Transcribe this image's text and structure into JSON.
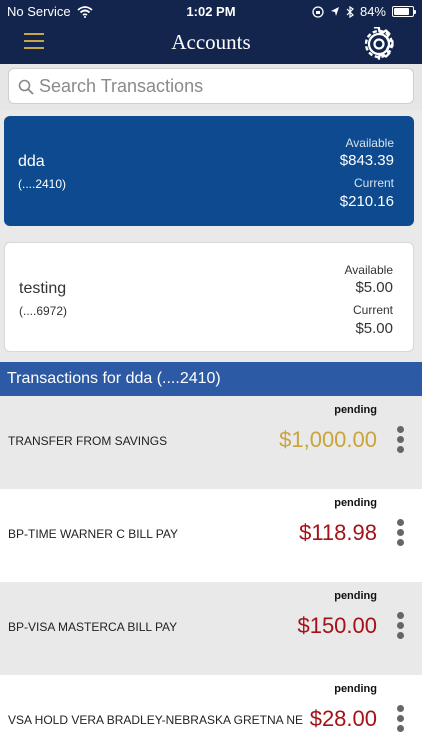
{
  "status_bar": {
    "carrier": "No Service",
    "time": "1:02 PM",
    "battery": "84%",
    "battery_level": 0.84
  },
  "nav": {
    "title": "Accounts"
  },
  "search": {
    "placeholder": "Search Transactions"
  },
  "accounts": [
    {
      "name": "dda",
      "number": "(....2410)",
      "available_label": "Available",
      "available": "$843.39",
      "current_label": "Current",
      "current": "$210.16"
    },
    {
      "name": "testing",
      "number": "(....6972)",
      "available_label": "Available",
      "available": "$5.00",
      "current_label": "Current",
      "current": "$5.00"
    }
  ],
  "transactions_header": "Transactions for dda (....2410)",
  "transactions": [
    {
      "status": "pending",
      "description": "TRANSFER FROM SAVINGS",
      "amount": "$1,000.00",
      "color": "#c9a43b"
    },
    {
      "status": "pending",
      "description": "BP-TIME WARNER C BILL PAY",
      "amount": "$118.98",
      "color": "#a31218"
    },
    {
      "status": "pending",
      "description": "BP-VISA MASTERCA BILL PAY",
      "amount": "$150.00",
      "color": "#a31218"
    },
    {
      "status": "pending",
      "description": "VSA HOLD VERA BRADLEY-NEBRASKA GRETNA NE",
      "amount": "$28.00",
      "color": "#a31218"
    }
  ]
}
